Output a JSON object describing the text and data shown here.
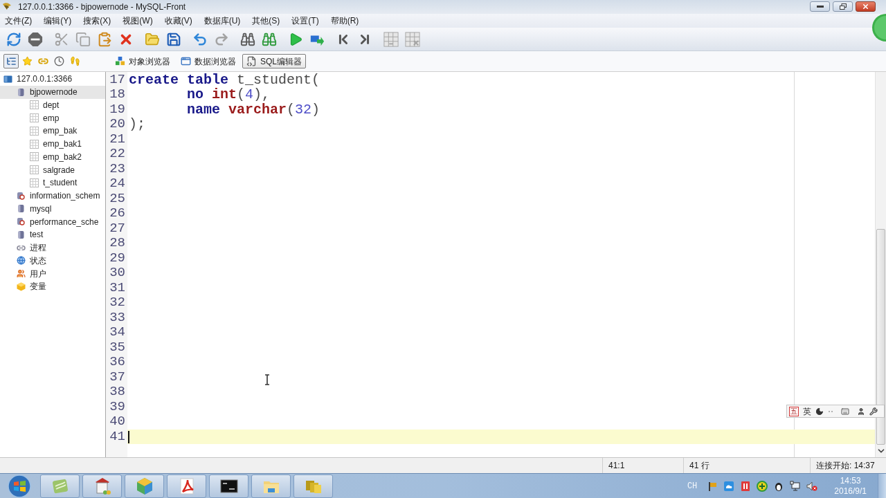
{
  "window": {
    "title": "127.0.0.1:3366 - bjpowernode - MySQL-Front"
  },
  "menu": [
    "文件(Z)",
    "编辑(Y)",
    "搜索(X)",
    "视图(W)",
    "收藏(V)",
    "数据库(U)",
    "其他(S)",
    "设置(T)",
    "帮助(R)"
  ],
  "toolbar": [
    [
      {
        "kind": "refresh",
        "disabled": false
      },
      {
        "kind": "stop",
        "disabled": false
      }
    ],
    [
      {
        "kind": "cut",
        "disabled": true
      },
      {
        "kind": "copy",
        "disabled": true
      },
      {
        "kind": "paste",
        "disabled": false
      },
      {
        "kind": "delete",
        "disabled": false
      }
    ],
    [
      {
        "kind": "open",
        "disabled": false
      },
      {
        "kind": "save",
        "disabled": false
      }
    ],
    [
      {
        "kind": "undo",
        "disabled": false
      },
      {
        "kind": "redo",
        "disabled": true
      }
    ],
    [
      {
        "kind": "find",
        "disabled": false
      },
      {
        "kind": "replace",
        "disabled": false
      }
    ],
    [
      {
        "kind": "run",
        "disabled": false
      },
      {
        "kind": "run_selection",
        "disabled": false
      }
    ],
    [
      {
        "kind": "first",
        "disabled": false
      },
      {
        "kind": "last",
        "disabled": false
      }
    ],
    [
      {
        "kind": "grid_insert",
        "disabled": true
      },
      {
        "kind": "grid_delete",
        "disabled": true
      }
    ]
  ],
  "side_tabs": [
    {
      "kind": "tree",
      "selected": true
    },
    {
      "kind": "favorites",
      "selected": false
    },
    {
      "kind": "links",
      "selected": false
    },
    {
      "kind": "history",
      "selected": false
    },
    {
      "kind": "steps",
      "selected": false
    }
  ],
  "view_tabs": [
    {
      "kind": "objects",
      "label": "对象浏览器",
      "selected": false
    },
    {
      "kind": "data",
      "label": "数据浏览器",
      "selected": false
    },
    {
      "kind": "sql",
      "label": "SQL编辑器",
      "selected": true
    }
  ],
  "tree": [
    {
      "kind": "server",
      "label": "127.0.0.1:3366",
      "selected": false,
      "children": [
        {
          "kind": "database",
          "label": "bjpowernode",
          "selected": true,
          "children": [
            {
              "kind": "table",
              "label": "dept",
              "selected": false
            },
            {
              "kind": "table",
              "label": "emp",
              "selected": false
            },
            {
              "kind": "table",
              "label": "emp_bak",
              "selected": false
            },
            {
              "kind": "table",
              "label": "emp_bak1",
              "selected": false
            },
            {
              "kind": "table",
              "label": "emp_bak2",
              "selected": false
            },
            {
              "kind": "table",
              "label": "salgrade",
              "selected": false
            },
            {
              "kind": "table",
              "label": "t_student",
              "selected": false
            }
          ]
        },
        {
          "kind": "system_db",
          "label": "information_schem",
          "selected": false
        },
        {
          "kind": "database",
          "label": "mysql",
          "selected": false
        },
        {
          "kind": "system_db",
          "label": "performance_sche",
          "selected": false
        },
        {
          "kind": "database",
          "label": "test",
          "selected": false
        },
        {
          "kind": "processes",
          "label": "进程",
          "selected": false
        },
        {
          "kind": "status",
          "label": "状态",
          "selected": false
        },
        {
          "kind": "users",
          "label": "用户",
          "selected": false
        },
        {
          "kind": "variables",
          "label": "变量",
          "selected": false
        }
      ]
    }
  ],
  "editor": {
    "lines": [
      {
        "number": "17",
        "current": false,
        "indented": false,
        "tokens": [
          {
            "kind": "keyword",
            "text": "create "
          },
          {
            "kind": "keyword",
            "text": "table "
          },
          {
            "kind": "plain",
            "text": "t_student("
          }
        ]
      },
      {
        "number": "18",
        "current": false,
        "indented": true,
        "tokens": [
          {
            "kind": "keyword",
            "text": "no "
          },
          {
            "kind": "type",
            "text": "int"
          },
          {
            "kind": "plain",
            "text": "("
          },
          {
            "kind": "number",
            "text": "4"
          },
          {
            "kind": "plain",
            "text": "),"
          }
        ]
      },
      {
        "number": "19",
        "current": false,
        "indented": true,
        "tokens": [
          {
            "kind": "keyword",
            "text": "name "
          },
          {
            "kind": "type",
            "text": "varchar"
          },
          {
            "kind": "plain",
            "text": "("
          },
          {
            "kind": "number",
            "text": "32"
          },
          {
            "kind": "plain",
            "text": ")"
          }
        ]
      },
      {
        "number": "20",
        "current": false,
        "indented": false,
        "tokens": [
          {
            "kind": "plain",
            "text": ");"
          }
        ]
      },
      {
        "number": "21",
        "current": false
      },
      {
        "number": "22",
        "current": false
      },
      {
        "number": "23",
        "current": false
      },
      {
        "number": "24",
        "current": false
      },
      {
        "number": "25",
        "current": false
      },
      {
        "number": "26",
        "current": false
      },
      {
        "number": "27",
        "current": false
      },
      {
        "number": "28",
        "current": false
      },
      {
        "number": "29",
        "current": false
      },
      {
        "number": "30",
        "current": false
      },
      {
        "number": "31",
        "current": false
      },
      {
        "number": "32",
        "current": false
      },
      {
        "number": "33",
        "current": false
      },
      {
        "number": "34",
        "current": false
      },
      {
        "number": "35",
        "current": false
      },
      {
        "number": "36",
        "current": false
      },
      {
        "number": "37",
        "current": false
      },
      {
        "number": "38",
        "current": false
      },
      {
        "number": "39",
        "current": false
      },
      {
        "number": "40",
        "current": false
      },
      {
        "number": "41",
        "current": true
      }
    ]
  },
  "ime_bar": {
    "logo": "五",
    "mode": "英"
  },
  "status_bar": {
    "position": "41:1",
    "line_count": "41 行",
    "connection": "连接开始: 14:37"
  },
  "taskbar": {
    "language": "CH",
    "time": "14:53",
    "date": "2016/9/1"
  }
}
